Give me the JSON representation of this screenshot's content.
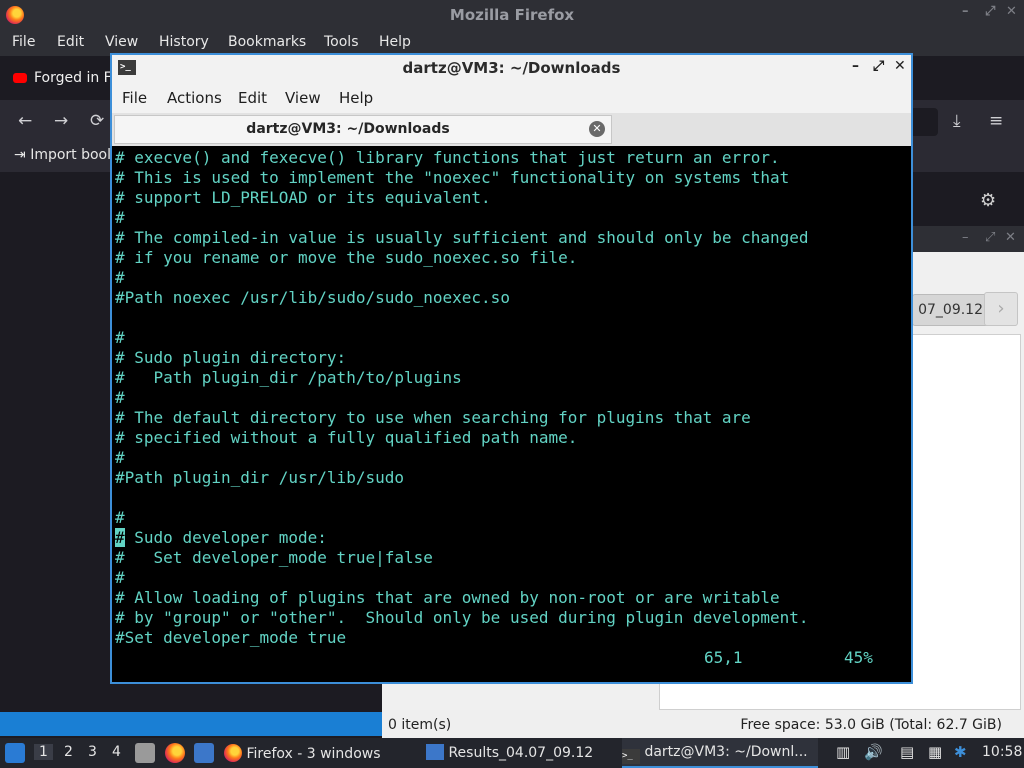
{
  "firefox": {
    "title": "Mozilla Firefox",
    "window_controls": [
      "–",
      "⤢",
      "✕"
    ],
    "menu": [
      "File",
      "Edit",
      "View",
      "History",
      "Bookmarks",
      "Tools",
      "Help"
    ],
    "tab_title": "Forged in Fi",
    "bookmark": "Import bool",
    "nav_icons": [
      "←",
      "→",
      "⟳",
      "⤓",
      "≡"
    ]
  },
  "file_manager": {
    "path_button": "07_09.12",
    "next_button": "›",
    "status_items": "0 item(s)",
    "status_free": "Free space: 53.0 GiB (Total: 62.7 GiB)"
  },
  "terminal": {
    "title": "dartz@VM3: ~/Downloads",
    "controls": [
      "–",
      "⤢",
      "✕"
    ],
    "menu": [
      "File",
      "Actions",
      "Edit",
      "View",
      "Help"
    ],
    "tab_title": "dartz@VM3: ~/Downloads",
    "tab_close": "✕",
    "lines": [
      "# execve() and fexecve() library functions that just return an error.",
      "# This is used to implement the \"noexec\" functionality on systems that",
      "# support LD_PRELOAD or its equivalent.",
      "#",
      "# The compiled-in value is usually sufficient and should only be changed",
      "# if you rename or move the sudo_noexec.so file.",
      "#",
      "#Path noexec /usr/lib/sudo/sudo_noexec.so",
      "",
      "#",
      "# Sudo plugin directory:",
      "#   Path plugin_dir /path/to/plugins",
      "#",
      "# The default directory to use when searching for plugins that are",
      "# specified without a fully qualified path name.",
      "#",
      "#Path plugin_dir /usr/lib/sudo",
      "",
      "#",
      " Sudo developer mode:",
      "#   Set developer_mode true|false",
      "#",
      "# Allow loading of plugins that are owned by non-root or are writable",
      "# by \"group\" or \"other\".  Should only be used during plugin development.",
      "#Set developer_mode true"
    ],
    "cursor_char": "#",
    "cursor_line": 19,
    "position": "65,1",
    "percent": "45%"
  },
  "taskbar": {
    "workspaces": [
      "1",
      "2",
      "3",
      "4"
    ],
    "tasks": [
      {
        "label": "Firefox - 3 windows"
      },
      {
        "label": "Results_04.07_09.12"
      },
      {
        "label": "dartz@VM3: ~/Downl..."
      }
    ],
    "clock": "10:58"
  }
}
